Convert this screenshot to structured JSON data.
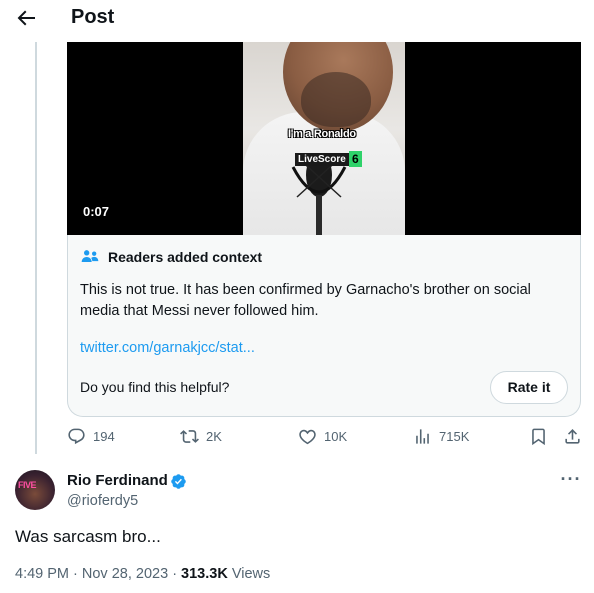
{
  "header": {
    "title": "Post",
    "back_icon": "arrow-left-icon"
  },
  "video": {
    "duration": "0:07",
    "caption": "I'm a Ronaldo",
    "watermark_text": "LiveScore",
    "watermark_mark": "6"
  },
  "context_note": {
    "title": "Readers added context",
    "icon": "people-icon",
    "body": "This is not true. It has been confirmed by Garnacho's brother on social media that Messi never followed him.",
    "link": "twitter.com/garnakjcc/stat...",
    "question": "Do you find this helpful?",
    "rate_label": "Rate it"
  },
  "actions": {
    "replies": "194",
    "reposts": "2K",
    "likes": "10K",
    "views": "715K"
  },
  "reply": {
    "author_name": "Rio Ferdinand",
    "author_handle": "@rioferdy5",
    "avatar_text": "FIVE",
    "text": "Was sarcasm bro...",
    "time": "4:49 PM",
    "date": "Nov 28, 2023",
    "views_count": "313.3K",
    "views_label": "Views"
  },
  "colors": {
    "accent": "#1d9bf0",
    "text": "#0f1419",
    "muted": "#536471",
    "border": "#cfd9de"
  }
}
